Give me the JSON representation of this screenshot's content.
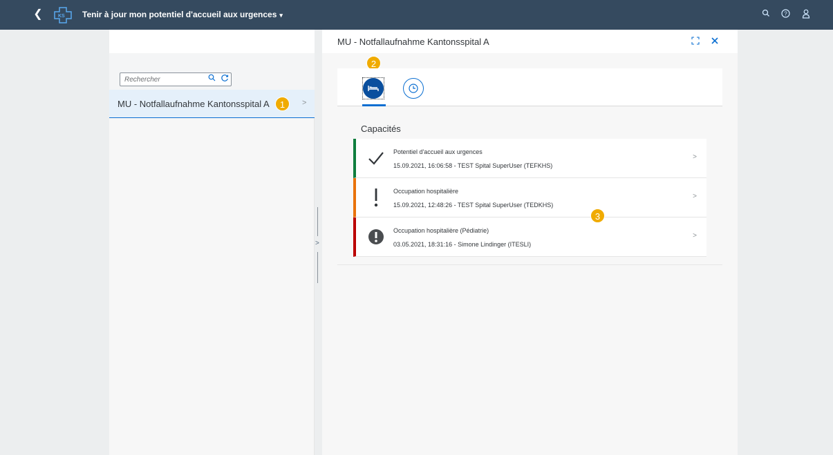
{
  "shell": {
    "title": "Tenir à jour mon potentiel d'accueil aux urgences",
    "caret": "▾",
    "icons": [
      "back-icon",
      "logo-icon",
      "search-icon",
      "help-icon",
      "user-icon"
    ],
    "color": "#354a5f"
  },
  "master": {
    "search_placeholder": "Rechercher",
    "items": [
      {
        "label": "MU - Notfallaufnahme Kantonsspital A",
        "badge": "1"
      }
    ]
  },
  "detail": {
    "title": "MU - Notfallaufnahme Kantonsspital A",
    "tabs": [
      {
        "icon": "bed-icon",
        "selected": true,
        "badge": "2"
      },
      {
        "icon": "clock-icon",
        "selected": false
      }
    ],
    "section_title": "Capacités",
    "section_badge": "3",
    "rows": [
      {
        "title": "Potentiel d'accueil aux urgences",
        "subtitle": "15.09.2021, 16:06:58 - TEST Spital SuperUser (TEFKHS)",
        "status": "success",
        "color": "#107e3e",
        "icon": "checkmark-icon"
      },
      {
        "title": "Occupation hospitalière",
        "subtitle": "15.09.2021, 12:48:26 - TEST Spital SuperUser (TEDKHS)",
        "status": "warning",
        "color": "#e9730c",
        "icon": "exclamation-icon"
      },
      {
        "title": "Occupation hospitalière (Pédiatrie)",
        "subtitle": "03.05.2021, 18:31:16 - Simone Lindinger (ITESLI)",
        "status": "error",
        "color": "#bb0000",
        "icon": "error-circle-icon"
      }
    ]
  },
  "colors": {
    "accent": "#0a6ed1",
    "badge": "#f0ab00"
  }
}
